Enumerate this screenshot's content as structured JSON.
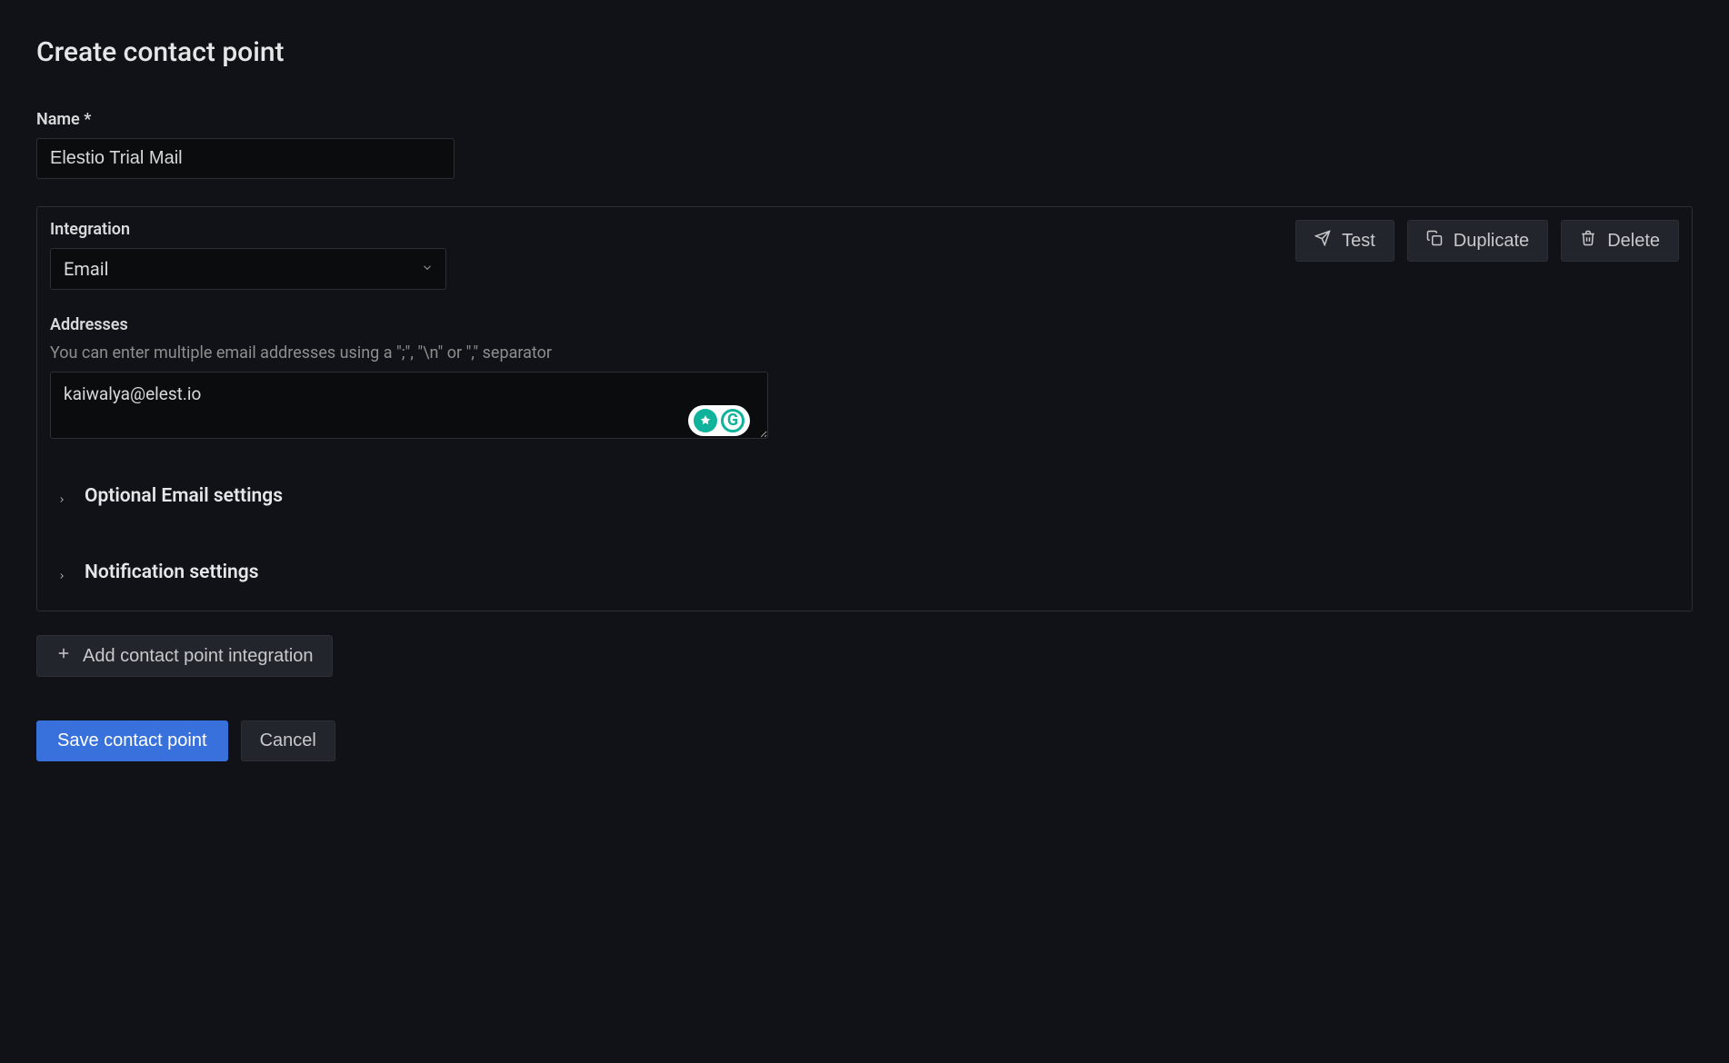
{
  "page": {
    "title": "Create contact point"
  },
  "fields": {
    "name_label": "Name *",
    "name_value": "Elestio Trial Mail"
  },
  "integration": {
    "label": "Integration",
    "selected": "Email",
    "actions": {
      "test": "Test",
      "duplicate": "Duplicate",
      "delete": "Delete"
    },
    "addresses": {
      "label": "Addresses",
      "hint": "You can enter multiple email addresses using a \";\", \"\\n\" or \",\" separator",
      "value": "kaiwalya@elest.io"
    },
    "collapsibles": {
      "optional_email": "Optional Email settings",
      "notification": "Notification settings"
    }
  },
  "buttons": {
    "add_integration": "Add contact point integration",
    "save": "Save contact point",
    "cancel": "Cancel"
  }
}
